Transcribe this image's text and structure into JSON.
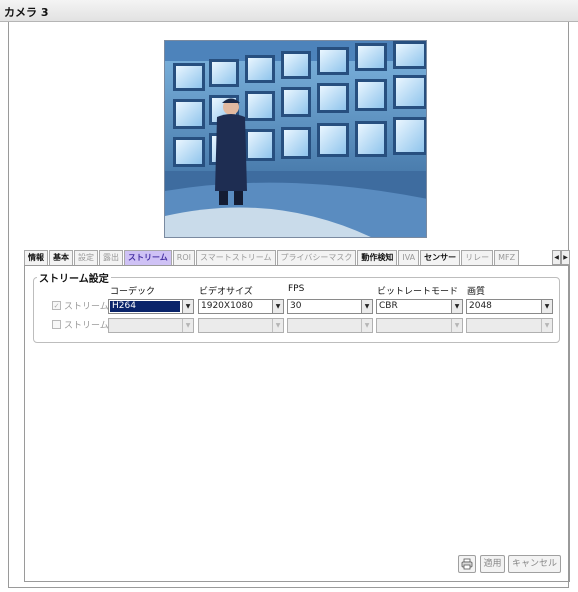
{
  "window": {
    "title": "カメラ 3"
  },
  "tabs": [
    {
      "label": "情報",
      "style": "bold"
    },
    {
      "label": "基本",
      "style": "bold"
    },
    {
      "label": "設定",
      "style": "dim"
    },
    {
      "label": "露出",
      "style": "dim"
    },
    {
      "label": "ストリーム",
      "style": "active"
    },
    {
      "label": "ROI",
      "style": "dim"
    },
    {
      "label": "スマートストリーム",
      "style": "dim"
    },
    {
      "label": "プライバシーマスク",
      "style": "dim"
    },
    {
      "label": "動作検知",
      "style": "bold"
    },
    {
      "label": "IVA",
      "style": "dim"
    },
    {
      "label": "センサー",
      "style": "bold"
    },
    {
      "label": "リレー",
      "style": "dim"
    },
    {
      "label": "MFZ",
      "style": "dim"
    }
  ],
  "tab_scroll": {
    "left_glyph": "◀",
    "right_glyph": "▶"
  },
  "stream_settings": {
    "group_title": "ストリーム設定",
    "columns": {
      "codec": "コーデック",
      "video_size": "ビデオサイズ",
      "fps": "FPS",
      "bitrate_mode": "ビットレートモード",
      "quality": "画質"
    },
    "rows": [
      {
        "label": "ストリーム1",
        "checked": true,
        "codec": "H264",
        "video_size": "1920X1080",
        "fps": "30",
        "bitrate_mode": "CBR",
        "quality": "2048"
      },
      {
        "label": "ストリーム2",
        "checked": false,
        "codec": "",
        "video_size": "",
        "fps": "",
        "bitrate_mode": "",
        "quality": ""
      }
    ]
  },
  "buttons": {
    "apply": "適用",
    "cancel": "キャンセル"
  },
  "colors": {
    "active_tab_bg": "#cfc2f5",
    "active_tab_text": "#4630a3",
    "selection": "#0a246a"
  }
}
